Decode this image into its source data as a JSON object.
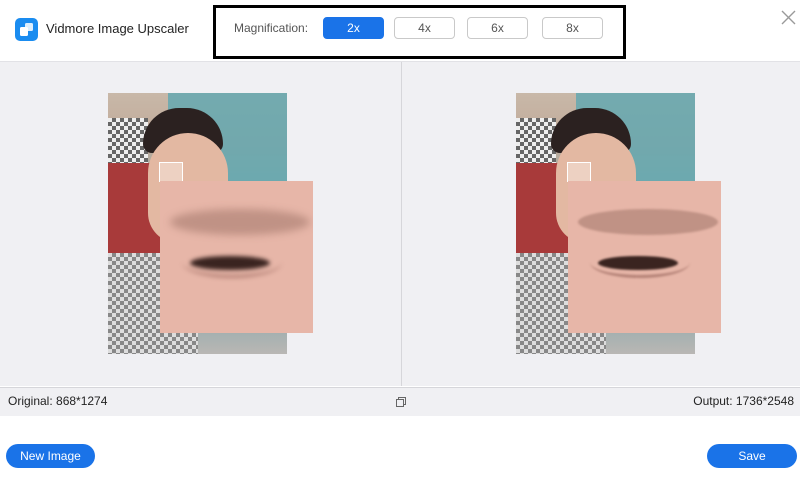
{
  "app": {
    "title": "Vidmore Image Upscaler",
    "logo_icon": "vidmore-logo-icon"
  },
  "magnification": {
    "label": "Magnification:",
    "options": [
      {
        "label": "2x",
        "selected": true
      },
      {
        "label": "4x",
        "selected": false
      },
      {
        "label": "6x",
        "selected": false
      },
      {
        "label": "8x",
        "selected": false
      }
    ]
  },
  "preview": {
    "original_text": "Original: 868*1274",
    "output_text": "Output: 1736*2548"
  },
  "actions": {
    "new_image": "New Image",
    "save": "Save"
  },
  "colors": {
    "accent": "#1a73e8",
    "preview_bg": "#f0f0f3"
  }
}
